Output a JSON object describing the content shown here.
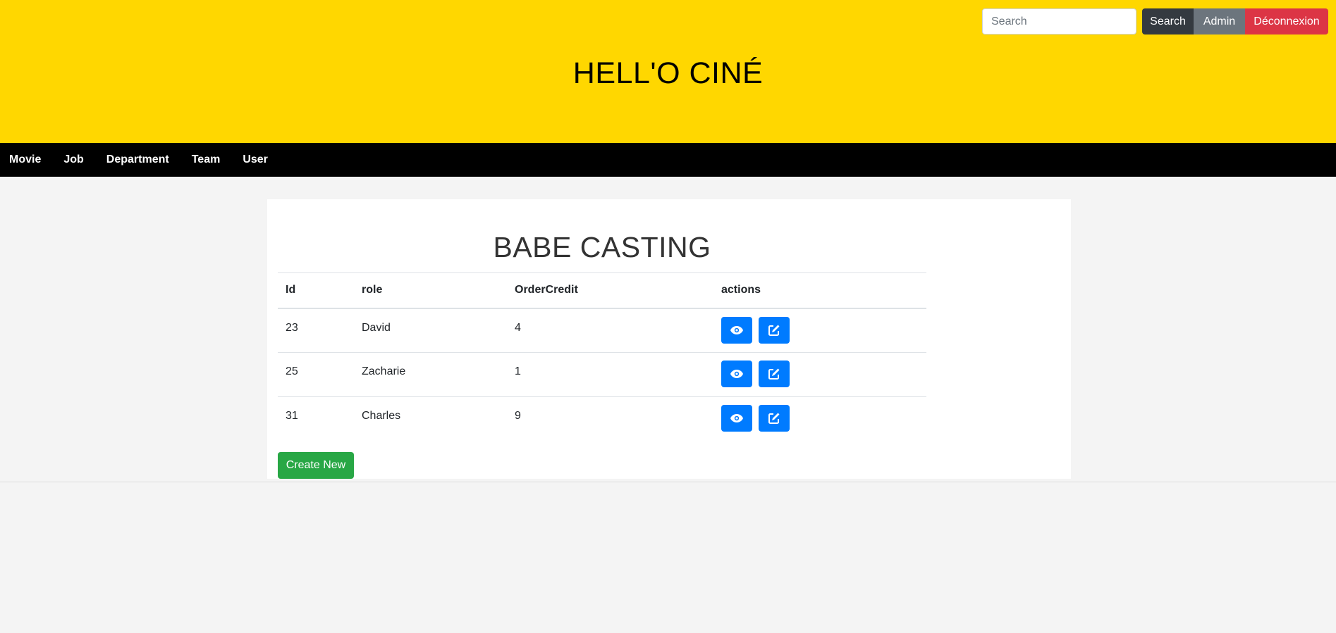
{
  "header": {
    "search_placeholder": "Search",
    "search_button": "Search",
    "admin_button": "Admin",
    "logout_button": "Déconnexion",
    "site_title": "HELL'O CINÉ",
    "background_color": "#ffd700"
  },
  "nav": {
    "items": [
      {
        "label": "Movie"
      },
      {
        "label": "Job"
      },
      {
        "label": "Department"
      },
      {
        "label": "Team"
      },
      {
        "label": "User"
      }
    ]
  },
  "main": {
    "title": "BABE CASTING",
    "table": {
      "columns": [
        "Id",
        "role",
        "OrderCredit",
        "actions"
      ],
      "rows": [
        {
          "id": "23",
          "role": "David",
          "order_credit": "4"
        },
        {
          "id": "25",
          "role": "Zacharie",
          "order_credit": "1"
        },
        {
          "id": "31",
          "role": "Charles",
          "order_credit": "9"
        }
      ],
      "action_icons": [
        "eye-icon",
        "edit-icon"
      ]
    },
    "create_button": "Create New"
  },
  "colors": {
    "primary": "#007bff",
    "success": "#28a745",
    "danger": "#dc3545",
    "secondary": "#6c757d",
    "dark": "#343a40"
  }
}
